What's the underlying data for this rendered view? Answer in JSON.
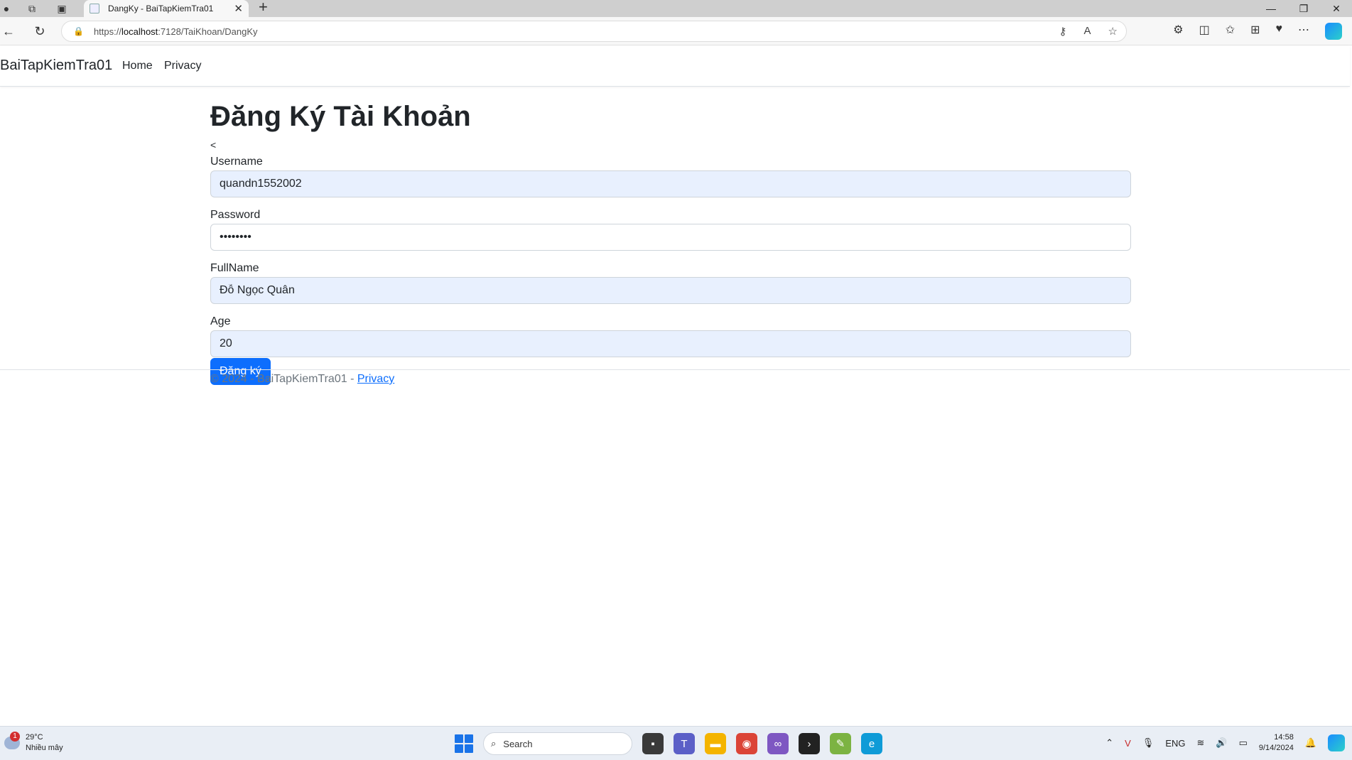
{
  "browser": {
    "tab_title": "DangKy - BaiTapKiemTra01",
    "tab_close": "✕",
    "new_tab": "+",
    "url_prefix": "https://",
    "url_host": "localhost",
    "url_path": ":7128/TaiKhoan/DangKy"
  },
  "navbar": {
    "brand": "BaiTapKiemTra01",
    "links": [
      "Home",
      "Privacy"
    ]
  },
  "page": {
    "title": "Đăng Ký Tài Khoản",
    "back_text": "<"
  },
  "form": {
    "username_label": "Username",
    "username_value": "quandn1552002",
    "password_label": "Password",
    "password_value": "••••••••",
    "fullname_label": "FullName",
    "fullname_value": "Đỗ Ngọc Quân",
    "age_label": "Age",
    "age_value": "20",
    "submit_label": "Đăng ký"
  },
  "footer": {
    "text": "© 2024 - BaiTapKiemTra01 - ",
    "link": "Privacy"
  },
  "taskbar": {
    "weather_badge": "1",
    "temperature": "29°C",
    "weather_desc": "Nhiều mây",
    "search_placeholder": "Search",
    "language": "ENG",
    "time": "14:58",
    "date": "9/14/2024"
  },
  "colors": {
    "primary": "#0d6efd",
    "autofill_bg": "#e8f0fe"
  }
}
